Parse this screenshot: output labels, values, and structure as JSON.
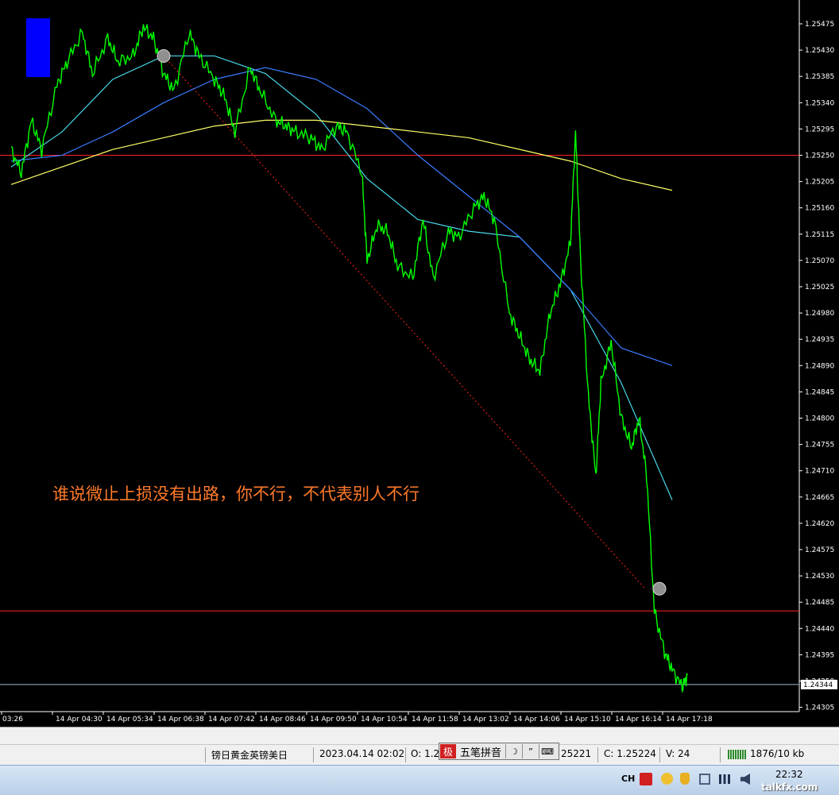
{
  "chart_data": {
    "type": "line",
    "y_ticks": [
      "1.25475",
      "1.25430",
      "1.25385",
      "1.25340",
      "1.25295",
      "1.25250",
      "1.25205",
      "1.25160",
      "1.25115",
      "1.25070",
      "1.25025",
      "1.24980",
      "1.24935",
      "1.24890",
      "1.24845",
      "1.24800",
      "1.24755",
      "1.24710",
      "1.24665",
      "1.24620",
      "1.24575",
      "1.24530",
      "1.24485",
      "1.24440",
      "1.24395",
      "1.24350",
      "1.24305"
    ],
    "x_ticks": [
      "03:26",
      "14 Apr 04:30",
      "14 Apr 05:34",
      "14 Apr 06:38",
      "14 Apr 07:42",
      "14 Apr 08:46",
      "14 Apr 09:50",
      "14 Apr 10:54",
      "14 Apr 11:58",
      "14 Apr 13:02",
      "14 Apr 14:06",
      "14 Apr 15:10",
      "14 Apr 16:14",
      "14 Apr 17:18"
    ],
    "ylim": [
      1.243,
      1.2549
    ],
    "current_price": "1.24344",
    "price_series": {
      "name": "",
      "color": "#00ff00",
      "points": [
        [
          0,
          1.2526
        ],
        [
          0.2,
          1.2522
        ],
        [
          0.4,
          1.2531
        ],
        [
          0.6,
          1.2526
        ],
        [
          0.9,
          1.2537
        ],
        [
          1.1,
          1.2541
        ],
        [
          1.4,
          1.2546
        ],
        [
          1.6,
          1.2539
        ],
        [
          1.9,
          1.2545
        ],
        [
          2.1,
          1.2541
        ],
        [
          2.4,
          1.2542
        ],
        [
          2.6,
          1.2547
        ],
        [
          2.8,
          1.2545
        ],
        [
          3.0,
          1.2539
        ],
        [
          3.2,
          1.2536
        ],
        [
          3.5,
          1.2546
        ],
        [
          3.7,
          1.2542
        ],
        [
          4.0,
          1.2538
        ],
        [
          4.2,
          1.2535
        ],
        [
          4.4,
          1.2529
        ],
        [
          4.7,
          1.254
        ],
        [
          4.9,
          1.2536
        ],
        [
          5.2,
          1.2531
        ],
        [
          5.4,
          1.253
        ],
        [
          5.6,
          1.2529
        ],
        [
          5.9,
          1.2528
        ],
        [
          6.1,
          1.2526
        ],
        [
          6.4,
          1.253
        ],
        [
          6.6,
          1.2529
        ],
        [
          6.9,
          1.2522
        ],
        [
          7.0,
          1.2507
        ],
        [
          7.2,
          1.2513
        ],
        [
          7.4,
          1.2512
        ],
        [
          7.6,
          1.2506
        ],
        [
          7.9,
          1.2504
        ],
        [
          8.1,
          1.2514
        ],
        [
          8.3,
          1.2504
        ],
        [
          8.6,
          1.2512
        ],
        [
          8.8,
          1.2511
        ],
        [
          9.1,
          1.2516
        ],
        [
          9.3,
          1.2518
        ],
        [
          9.5,
          1.2514
        ],
        [
          9.8,
          1.2498
        ],
        [
          10.0,
          1.2494
        ],
        [
          10.2,
          1.249
        ],
        [
          10.4,
          1.2488
        ],
        [
          10.6,
          1.2498
        ],
        [
          10.8,
          1.2503
        ],
        [
          11.0,
          1.251
        ],
        [
          11.1,
          1.2529
        ],
        [
          11.2,
          1.2507
        ],
        [
          11.35,
          1.2484
        ],
        [
          11.5,
          1.247
        ],
        [
          11.6,
          1.2486
        ],
        [
          11.8,
          1.2493
        ],
        [
          12.0,
          1.248
        ],
        [
          12.2,
          1.2475
        ],
        [
          12.35,
          1.248
        ],
        [
          12.5,
          1.247
        ],
        [
          12.65,
          1.2447
        ],
        [
          12.85,
          1.244
        ],
        [
          13.0,
          1.2437
        ],
        [
          13.2,
          1.2434
        ],
        [
          13.3,
          1.2436
        ]
      ]
    },
    "moving_averages": [
      {
        "name": "",
        "color": "#48d8e8",
        "points": [
          [
            0,
            1.2523
          ],
          [
            1,
            1.2529
          ],
          [
            2,
            1.2538
          ],
          [
            3,
            1.2542
          ],
          [
            4,
            1.2542
          ],
          [
            5,
            1.2539
          ],
          [
            6,
            1.2532
          ],
          [
            7,
            1.2521
          ],
          [
            8,
            1.2514
          ],
          [
            9,
            1.2512
          ],
          [
            10,
            1.2511
          ],
          [
            11,
            1.2502
          ],
          [
            12,
            1.2486
          ],
          [
            13,
            1.2466
          ]
        ]
      },
      {
        "name": "",
        "color": "#3a7cff",
        "points": [
          [
            0,
            1.2524
          ],
          [
            1,
            1.2525
          ],
          [
            2,
            1.2529
          ],
          [
            3,
            1.2534
          ],
          [
            4,
            1.2538
          ],
          [
            5,
            1.254
          ],
          [
            6,
            1.2538
          ],
          [
            7,
            1.2533
          ],
          [
            8,
            1.2525
          ],
          [
            9,
            1.2518
          ],
          [
            10,
            1.2511
          ],
          [
            11,
            1.2502
          ],
          [
            12,
            1.2492
          ],
          [
            13,
            1.2489
          ]
        ]
      },
      {
        "name": "",
        "color": "#ffff66",
        "points": [
          [
            0,
            1.252
          ],
          [
            1,
            1.2523
          ],
          [
            2,
            1.2526
          ],
          [
            3,
            1.2528
          ],
          [
            4,
            1.253
          ],
          [
            5,
            1.2531
          ],
          [
            6,
            1.2531
          ],
          [
            7,
            1.253
          ],
          [
            8,
            1.2529
          ],
          [
            9,
            1.2528
          ],
          [
            10,
            1.2526
          ],
          [
            11,
            1.2524
          ],
          [
            12,
            1.2521
          ],
          [
            13,
            1.2519
          ]
        ]
      }
    ],
    "horizontal_lines": [
      {
        "value": 1.2525,
        "color": "#ff2020"
      },
      {
        "value": 1.2447,
        "color": "#ff2020"
      },
      {
        "value": 1.24344,
        "color": "#a8b4d8"
      }
    ],
    "trendline": {
      "from": [
        3.0,
        1.2542
      ],
      "to": [
        12.45,
        1.2451
      ],
      "color": "#ff2020",
      "style": "dotted"
    },
    "annotation": "谁说微止上损没有出路，你不行，不代表别人不行"
  },
  "status_bar": {
    "symbol": "镑日黄金英镑美日",
    "datetime": "2023.04.14 02:02",
    "open": "O: 1.2",
    "high_partial": "25221",
    "close": "C: 1.25224",
    "volume": "V: 24",
    "traffic": "1876/10 kb"
  },
  "ime": {
    "logo": "极",
    "label": "五笔拼音",
    "moon": "☽",
    "punct": "”",
    "keyboard": "⌨"
  },
  "taskbar": {
    "lang": "CH",
    "clock": "22:32"
  },
  "watermark": "talkfx.com",
  "colors": {
    "background": "#000000",
    "price": "#00ff00",
    "annotation": "#ff7a2a"
  }
}
